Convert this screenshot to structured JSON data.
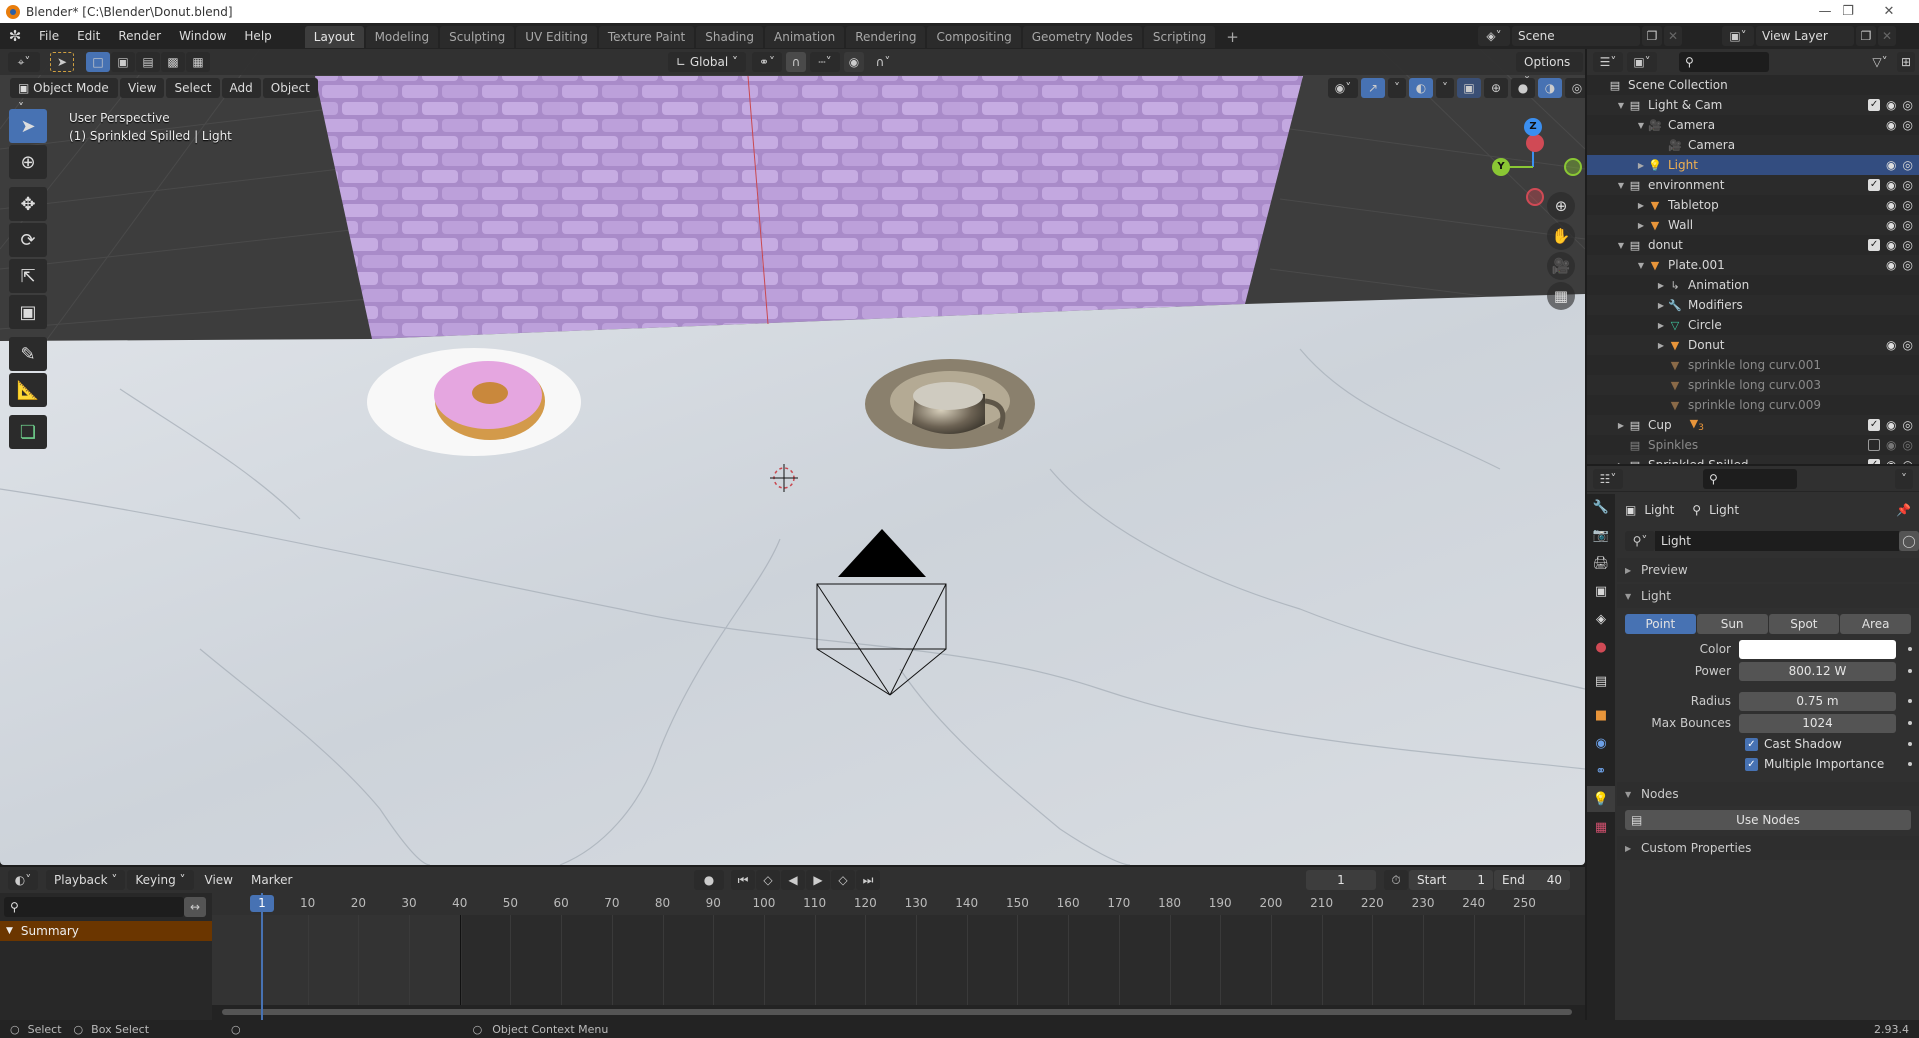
{
  "window": {
    "title": "Blender* [C:\\Blender\\Donut.blend]",
    "controls": [
      "minimize",
      "maximize",
      "close"
    ]
  },
  "menubar": {
    "items": [
      "File",
      "Edit",
      "Render",
      "Window",
      "Help"
    ]
  },
  "workspaces": {
    "active": "Layout",
    "tabs": [
      "Layout",
      "Modeling",
      "Sculpting",
      "UV Editing",
      "Texture Paint",
      "Shading",
      "Animation",
      "Rendering",
      "Compositing",
      "Geometry Nodes",
      "Scripting"
    ],
    "add_label": "+"
  },
  "scene_selector": {
    "scene": "Scene",
    "view_layer": "View Layer"
  },
  "viewport": {
    "mode": "Object Mode",
    "header_menus": [
      "View",
      "Select",
      "Add",
      "Object"
    ],
    "transform_orientation": "Global",
    "options_label": "Options",
    "info_line1": "User Perspective",
    "info_line2": "(1) Sprinkled Spilled | Light",
    "gizmo": {
      "z": "Z",
      "y": "Y"
    }
  },
  "outliner": {
    "search_placeholder": "",
    "rows": [
      {
        "label": "Scene Collection",
        "type": "collection",
        "depth": 0,
        "expand": "",
        "checkbox": null
      },
      {
        "label": "Light & Cam",
        "type": "collection",
        "depth": 1,
        "expand": "open",
        "checkbox": true
      },
      {
        "label": "Camera",
        "type": "camera-object",
        "depth": 2,
        "expand": "open",
        "checkbox": null,
        "visible": true
      },
      {
        "label": "Camera",
        "type": "camera-data",
        "depth": 3,
        "expand": "",
        "checkbox": null
      },
      {
        "label": "Light",
        "type": "light-object",
        "depth": 2,
        "expand": "closed",
        "checkbox": null,
        "visible": true,
        "selected": true
      },
      {
        "label": "environment",
        "type": "collection",
        "depth": 1,
        "expand": "open",
        "checkbox": true
      },
      {
        "label": "Tabletop",
        "type": "mesh-object",
        "depth": 2,
        "expand": "closed",
        "checkbox": null,
        "visible": true
      },
      {
        "label": "Wall",
        "type": "mesh-object",
        "depth": 2,
        "expand": "closed",
        "checkbox": null,
        "visible": true
      },
      {
        "label": "donut",
        "type": "collection",
        "depth": 1,
        "expand": "open",
        "checkbox": true
      },
      {
        "label": "Plate.001",
        "type": "mesh-object",
        "depth": 2,
        "expand": "open",
        "checkbox": null,
        "visible": true
      },
      {
        "label": "Animation",
        "type": "animation",
        "depth": 3,
        "expand": "closed",
        "checkbox": null
      },
      {
        "label": "Modifiers",
        "type": "modifiers",
        "depth": 3,
        "expand": "closed",
        "checkbox": null
      },
      {
        "label": "Circle",
        "type": "mesh-data",
        "depth": 3,
        "expand": "closed",
        "checkbox": null
      },
      {
        "label": "Donut",
        "type": "mesh-object",
        "depth": 3,
        "expand": "closed",
        "checkbox": null,
        "visible": true
      },
      {
        "label": "sprinkle long curv.001",
        "type": "mesh-object-dim",
        "depth": 3,
        "expand": "",
        "checkbox": null
      },
      {
        "label": "sprinkle long curv.003",
        "type": "mesh-object-dim",
        "depth": 3,
        "expand": "",
        "checkbox": null
      },
      {
        "label": "sprinkle long curv.009",
        "type": "mesh-object-dim",
        "depth": 3,
        "expand": "",
        "checkbox": null
      },
      {
        "label": "Cup",
        "type": "collection",
        "depth": 1,
        "expand": "closed",
        "checkbox": true,
        "badge": "3"
      },
      {
        "label": "Spinkles",
        "type": "collection-dim",
        "depth": 1,
        "expand": "",
        "checkbox": false
      },
      {
        "label": "Sprinkled Spilled",
        "type": "collection",
        "depth": 1,
        "expand": "closed",
        "checkbox": true
      }
    ]
  },
  "properties": {
    "breadcrumb": [
      "Light",
      "Light"
    ],
    "datablock_name": "Light",
    "panels": {
      "preview": "Preview",
      "light": "Light",
      "nodes": "Nodes",
      "custom_properties": "Custom Properties"
    },
    "light_types": [
      "Point",
      "Sun",
      "Spot",
      "Area"
    ],
    "active_light_type": "Point",
    "fields": [
      {
        "label": "Color",
        "value": "",
        "color": "#ffffff"
      },
      {
        "label": "Power",
        "value": "800.12 W"
      },
      {
        "label": "Radius",
        "value": "0.75 m"
      },
      {
        "label": "Max Bounces",
        "value": "1024"
      }
    ],
    "checkboxes": [
      {
        "label": "Cast Shadow",
        "checked": true
      },
      {
        "label": "Multiple Importance",
        "checked": true
      }
    ],
    "use_nodes_label": "Use Nodes"
  },
  "timeline": {
    "menus": [
      "Playback",
      "Keying",
      "View",
      "Marker"
    ],
    "current_frame": "1",
    "start_label": "Start",
    "start": "1",
    "end_label": "End",
    "end": "40",
    "summary_label": "Summary",
    "ruler_ticks": [
      "10",
      "20",
      "30",
      "40",
      "50",
      "60",
      "70",
      "80",
      "90",
      "100",
      "110",
      "120",
      "130",
      "140",
      "150",
      "160",
      "170",
      "180",
      "190",
      "200",
      "210",
      "220",
      "230",
      "240",
      "250"
    ],
    "playhead": "1"
  },
  "statusbar": {
    "select": "Select",
    "box_select": "Box Select",
    "context_menu": "Object Context Menu",
    "version": "2.93.4"
  },
  "colors": {
    "accent": "#4772b3",
    "selected_row": "#334d80",
    "summary_bg": "#6b3600",
    "light_label": "#f0b050",
    "brick": "#b79ad6",
    "marble": "#d8dde2"
  }
}
